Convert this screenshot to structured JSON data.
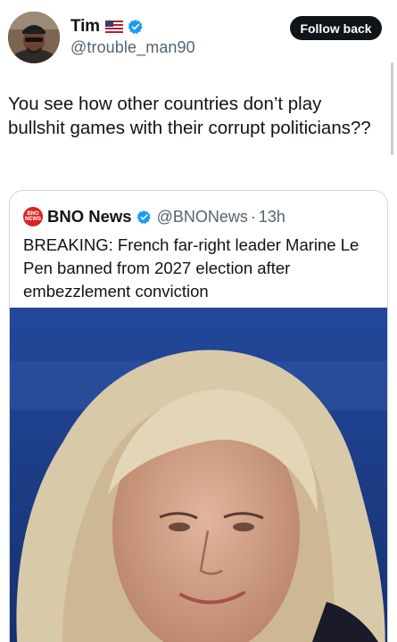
{
  "author": {
    "name": "Tim",
    "handle": "@trouble_man90",
    "flag_icon": "us-flag-icon",
    "verified_icon": "verified-badge-icon"
  },
  "actions": {
    "follow_label": "Follow back"
  },
  "tweet": {
    "text": "You see how other countries don’t play bullshit games with their corrupt politicians??"
  },
  "quoted": {
    "logo_text": [
      "BNO",
      "NEWS"
    ],
    "name": "BNO News",
    "handle": "@BNONews",
    "separator": "·",
    "time": "13h",
    "text": "BREAKING: French far-right leader Marine Le Pen banned from 2027 election after embezzlement conviction",
    "media_icon": "news-photo"
  },
  "colors": {
    "text": "#0f1419",
    "secondary": "#536471",
    "verified": "#1d9bf0",
    "bno_red": "#d62424",
    "border": "#cfd9de",
    "photo_background": "#1d3f87"
  }
}
